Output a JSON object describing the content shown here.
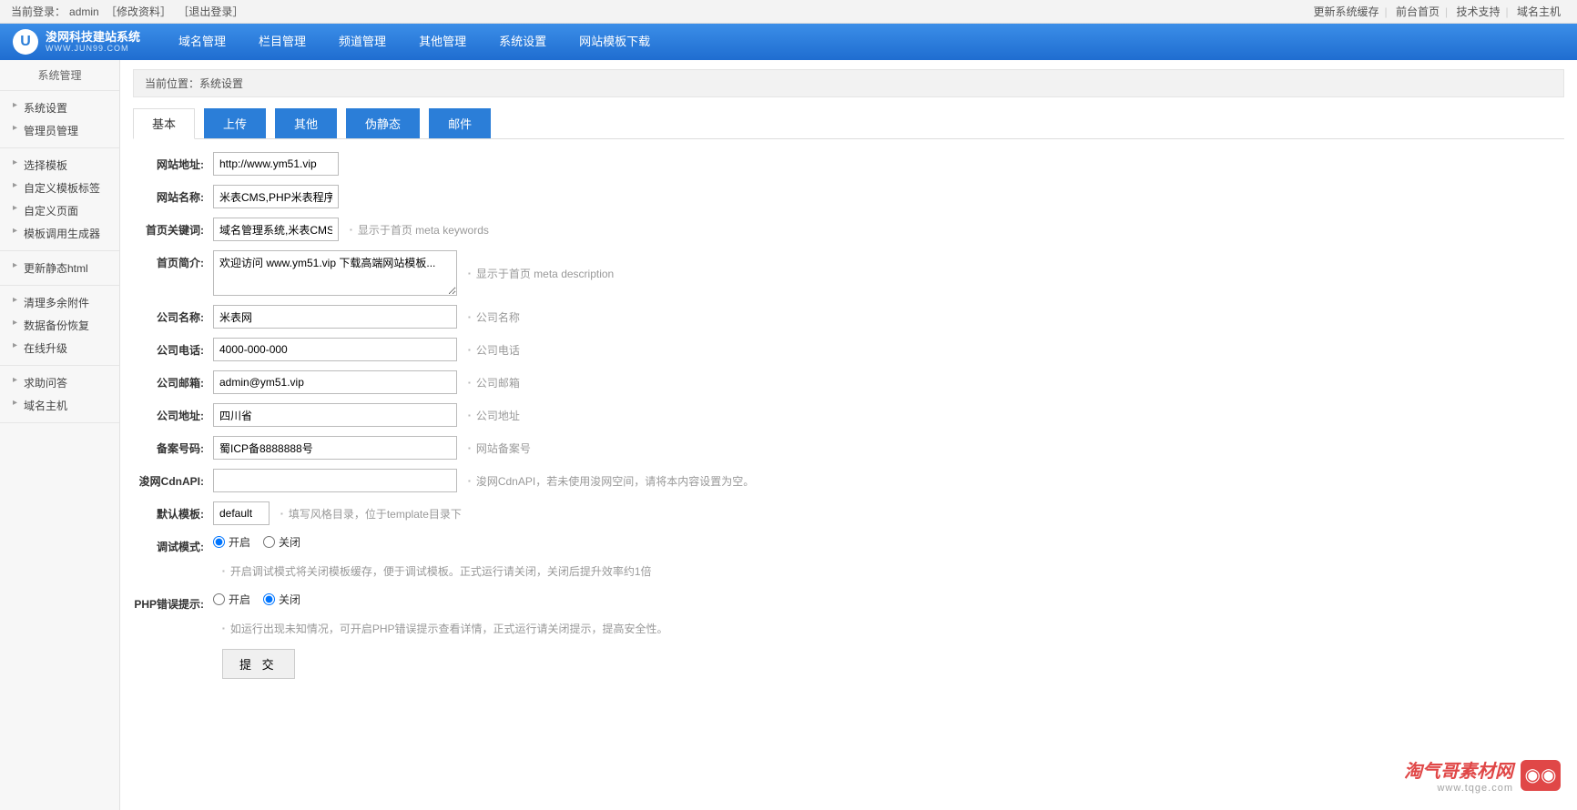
{
  "topbar": {
    "login_label": "当前登录：",
    "user": "admin",
    "edit_profile": "［修改资料］",
    "logout": "［退出登录］",
    "links": [
      "更新系统缓存",
      "前台首页",
      "技术支持",
      "域名主机"
    ]
  },
  "logo": {
    "title": "浚网科技建站系统",
    "sub": "WWW.JUN99.COM"
  },
  "nav": [
    "域名管理",
    "栏目管理",
    "频道管理",
    "其他管理",
    "系统设置",
    "网站模板下载"
  ],
  "sidebar": {
    "title": "系统管理",
    "groups": [
      [
        "系统设置",
        "管理员管理"
      ],
      [
        "选择模板",
        "自定义模板标签",
        "自定义页面",
        "模板调用生成器"
      ],
      [
        "更新静态html"
      ],
      [
        "清理多余附件",
        "数据备份恢复",
        "在线升级"
      ],
      [
        "求助问答",
        "域名主机"
      ]
    ]
  },
  "breadcrumb": {
    "label": "当前位置：",
    "value": "系统设置"
  },
  "tabs": [
    "基本",
    "上传",
    "其他",
    "伪静态",
    "邮件"
  ],
  "form": {
    "site_url": {
      "label": "网站地址",
      "value": "http://www.ym51.vip"
    },
    "site_name": {
      "label": "网站名称",
      "value": "米表CMS,PHP米表程序,html"
    },
    "keywords": {
      "label": "首页关键词",
      "value": "域名管理系统,米表CMS,米",
      "hint": "显示于首页 meta keywords"
    },
    "description": {
      "label": "首页简介",
      "value": "欢迎访问 www.ym51.vip 下载高端网站模板...",
      "hint": "显示于首页 meta description"
    },
    "company": {
      "label": "公司名称",
      "value": "米表网",
      "hint": "公司名称"
    },
    "phone": {
      "label": "公司电话",
      "value": "4000-000-000",
      "hint": "公司电话"
    },
    "email": {
      "label": "公司邮箱",
      "value": "admin@ym51.vip",
      "hint": "公司邮箱"
    },
    "address": {
      "label": "公司地址",
      "value": "四川省",
      "hint": "公司地址"
    },
    "icp": {
      "label": "备案号码",
      "value": "蜀ICP备8888888号",
      "hint": "网站备案号"
    },
    "cdn": {
      "label": "浚网CdnAPI",
      "value": "",
      "hint": "浚网CdnAPI，若未使用浚网空间，请将本内容设置为空。"
    },
    "template": {
      "label": "默认模板",
      "value": "default",
      "hint": "填写风格目录，位于template目录下"
    },
    "debug": {
      "label": "调试模式",
      "on": "开启",
      "off": "关闭",
      "note": "开启调试模式将关闭模板缓存，便于调试模板。正式运行请关闭，关闭后提升效率约1倍"
    },
    "phperr": {
      "label": "PHP错误提示",
      "on": "开启",
      "off": "关闭",
      "note": "如运行出现未知情况，可开启PHP错误提示查看详情，正式运行请关闭提示，提高安全性。"
    },
    "submit": "提 交"
  },
  "watermark": {
    "line1": "淘气哥素材网",
    "line2": "www.tqge.com"
  }
}
